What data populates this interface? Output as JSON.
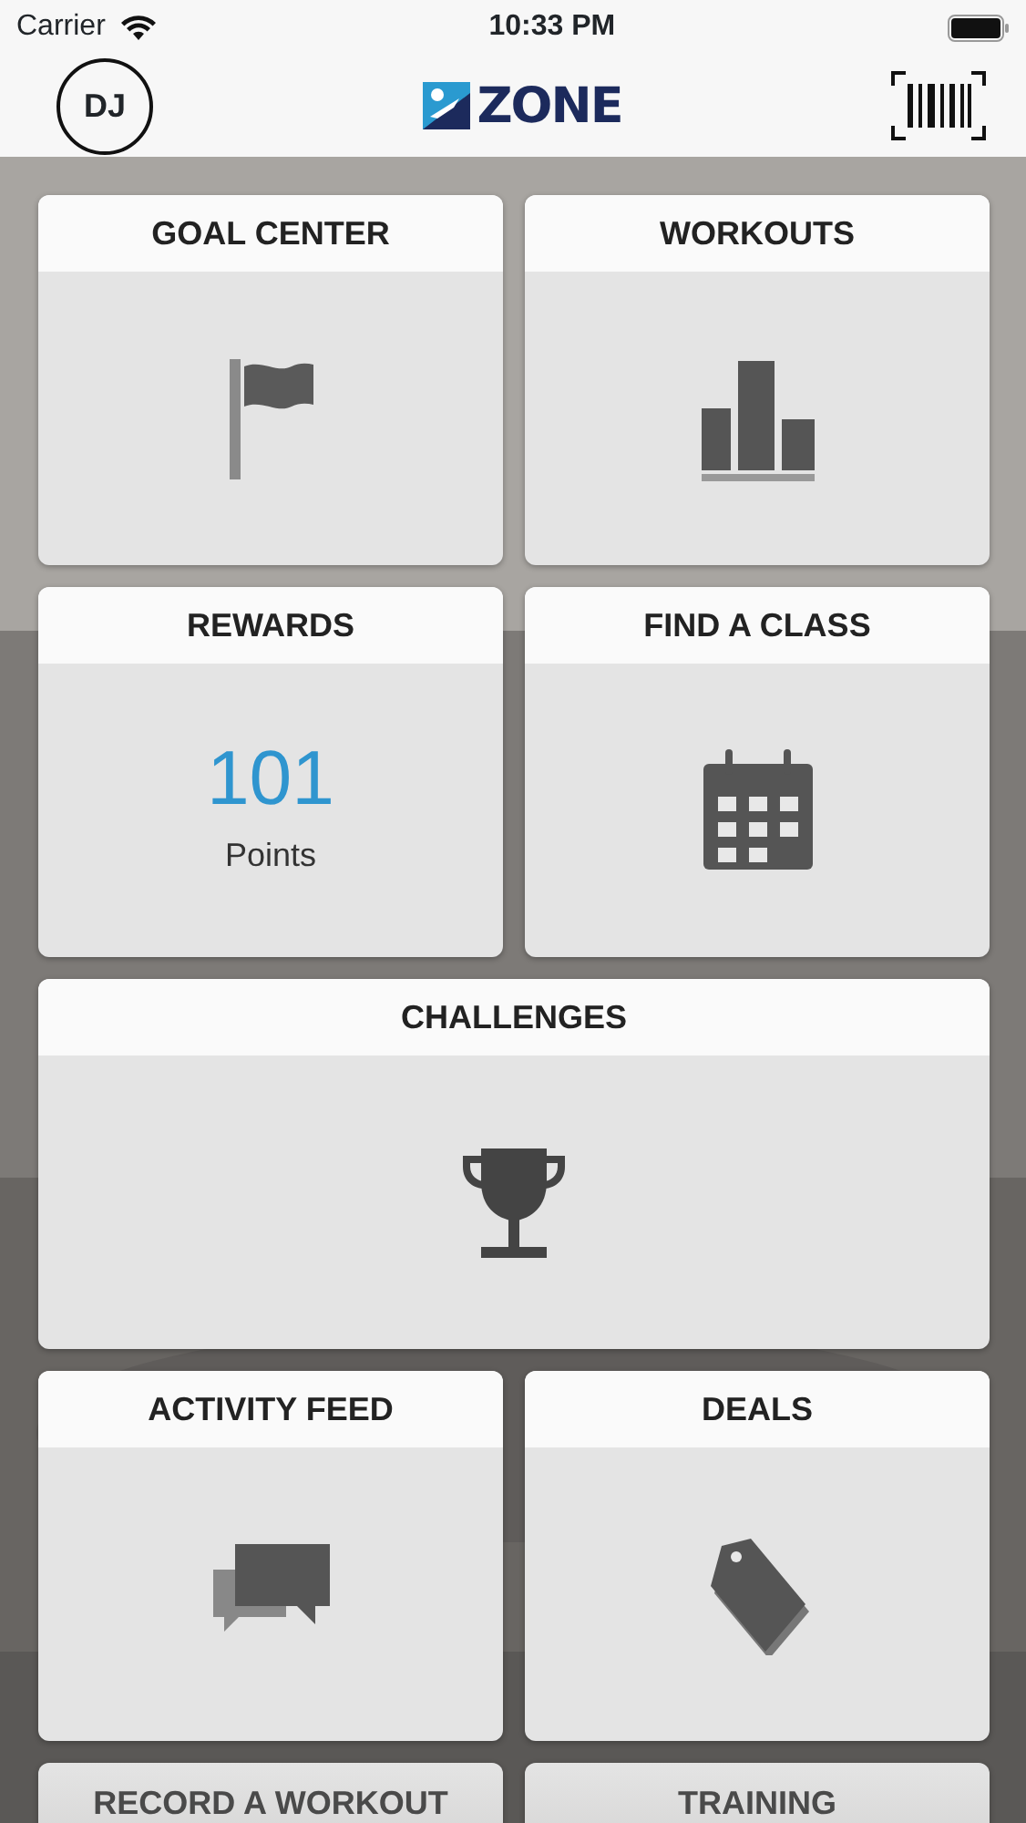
{
  "status_bar": {
    "carrier": "Carrier",
    "time": "10:33 PM"
  },
  "header": {
    "avatar": "DJ",
    "logo": "ZONE"
  },
  "tiles": [
    {
      "title": "GOAL CENTER",
      "kind": "flag",
      "wide": false
    },
    {
      "title": "WORKOUTS",
      "kind": "chart",
      "wide": false
    },
    {
      "title": "REWARDS",
      "kind": "points",
      "wide": false,
      "points": "101",
      "unit": "Points"
    },
    {
      "title": "FIND A CLASS",
      "kind": "calendar",
      "wide": false
    },
    {
      "title": "CHALLENGES",
      "kind": "trophy",
      "wide": true
    },
    {
      "title": "ACTIVITY FEED",
      "kind": "chat",
      "wide": false
    },
    {
      "title": "DEALS",
      "kind": "tag",
      "wide": false
    },
    {
      "title": "RECORD A WORKOUT",
      "kind": "cut",
      "wide": false
    },
    {
      "title": "TRAINING",
      "kind": "cut",
      "wide": false
    }
  ]
}
